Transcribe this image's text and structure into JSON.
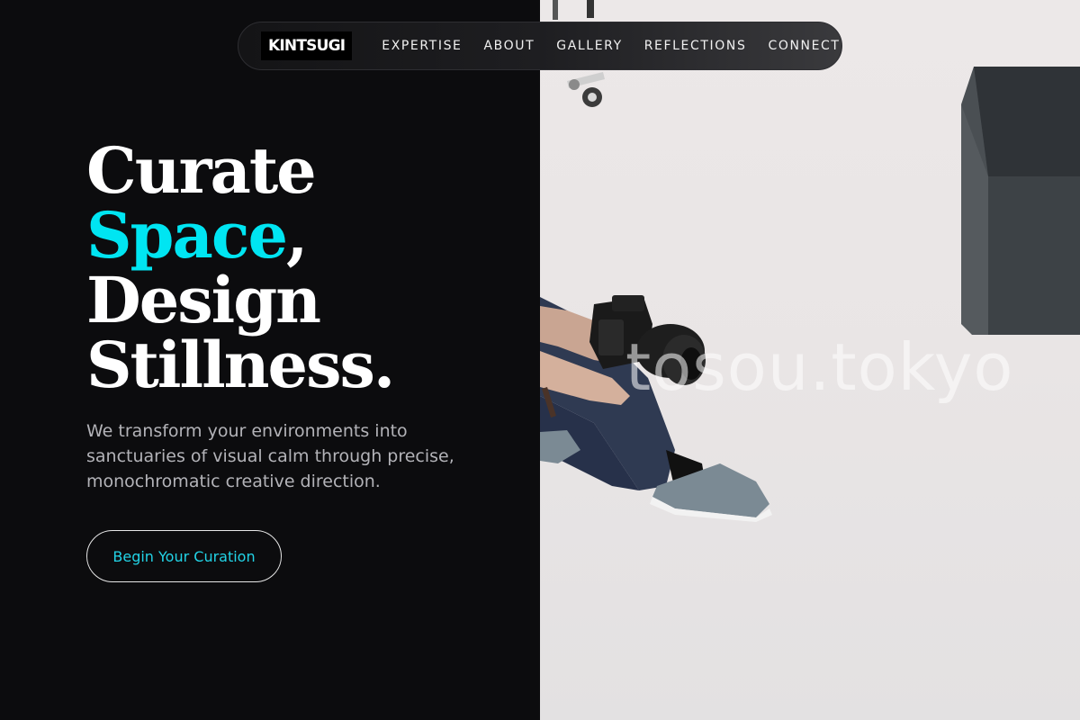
{
  "nav": {
    "logo": "KINTSUGI",
    "links": [
      "EXPERTISE",
      "ABOUT",
      "GALLERY",
      "REFLECTIONS",
      "CONNECT"
    ]
  },
  "hero": {
    "headline": {
      "line1": "Curate",
      "accent_word": "Space",
      "accent_punct": ",",
      "line3": "Design",
      "line4": "Stillness."
    },
    "subtext": "We transform your environments into sanctuaries of visual calm through precise, monochromatic creative direction.",
    "cta_label": "Begin Your Curation"
  },
  "photo": {
    "watermark": "tosou.tokyo"
  },
  "colors": {
    "background": "#0c0c0e",
    "accent": "#00e5f2",
    "cta_text": "#22d3e6"
  }
}
